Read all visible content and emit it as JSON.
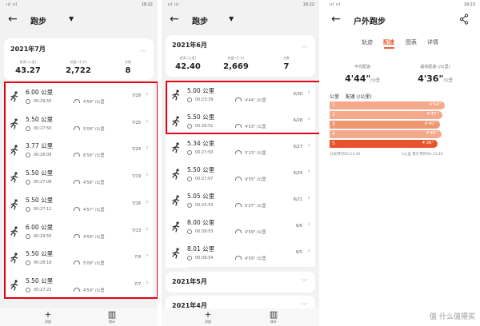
{
  "panels": [
    {
      "status": {
        "signal": "ııl ııl",
        "icons": "✱ ◎ ▭",
        "time": "19:22"
      },
      "title": "跑步",
      "summary": {
        "month": "2021年7月",
        "stats": [
          {
            "label": "距离 (公里)",
            "value": "43.27"
          },
          {
            "label": "热量 (千卡)",
            "value": "2,722"
          },
          {
            "label": "次数",
            "value": "8"
          }
        ]
      },
      "runs": [
        {
          "distance": "6.00 公里",
          "duration": "00:29:55",
          "pace": "4'59\" /公里",
          "date": "7/28"
        },
        {
          "distance": "5.50 公里",
          "duration": "00:27:50",
          "pace": "5'04\" /公里",
          "date": "7/25"
        },
        {
          "distance": "3.77 公里",
          "duration": "00:26:09",
          "pace": "6'56\" /公里",
          "date": "7/24"
        },
        {
          "distance": "5.50 公里",
          "duration": "00:27:08",
          "pace": "4'56\" /公里",
          "date": "7/19"
        },
        {
          "distance": "5.50 公里",
          "duration": "00:27:11",
          "pace": "4'57\" /公里",
          "date": "7/16"
        },
        {
          "distance": "6.00 公里",
          "duration": "00:29:55",
          "pace": "4'59\" /公里",
          "date": "7/13"
        },
        {
          "distance": "5.50 公里",
          "duration": "00:28:18",
          "pace": "5'09\" /公里",
          "date": "7/9"
        },
        {
          "distance": "5.50 公里",
          "duration": "00:27:23",
          "pace": "4'59\" /公里",
          "date": "7/7"
        }
      ],
      "bottom": {
        "add_label": "添加",
        "stats_label": "统计"
      }
    },
    {
      "status": {
        "signal": "ııl ııl",
        "icons": "✱ ◎ ▭",
        "time": "19:22"
      },
      "title": "跑步",
      "summary": {
        "month": "2021年6月",
        "stats": [
          {
            "label": "距离 (公里)",
            "value": "42.40"
          },
          {
            "label": "热量 (千卡)",
            "value": "2,669"
          },
          {
            "label": "次数",
            "value": "7"
          }
        ]
      },
      "runs": [
        {
          "distance": "5.00 公里",
          "duration": "00:23:39",
          "pace": "4'44\" /公里",
          "date": "6/30"
        },
        {
          "distance": "5.50 公里",
          "duration": "00:26:51",
          "pace": "4'53\" /公里",
          "date": "6/28"
        },
        {
          "distance": "5.34 公里",
          "duration": "00:27:50",
          "pace": "5'13\" /公里",
          "date": "6/27"
        },
        {
          "distance": "5.50 公里",
          "duration": "00:27:07",
          "pace": "4'55\" /公里",
          "date": "6/24"
        },
        {
          "distance": "5.05 公里",
          "duration": "00:25:53",
          "pace": "5'07\" /公里",
          "date": "6/21"
        },
        {
          "distance": "8.00 公里",
          "duration": "00:39:53",
          "pace": "4'59\" /公里",
          "date": "6/6"
        },
        {
          "distance": "8.01 公里",
          "duration": "00:39:54",
          "pace": "4'59\" /公里",
          "date": "6/5"
        }
      ],
      "collapsed_months": [
        "2021年5月",
        "2021年4月"
      ],
      "bottom": {
        "add_label": "添加",
        "stats_label": "统计"
      }
    },
    {
      "status": {
        "signal": "ııl ııl",
        "icons": "✱ ◎ ▭",
        "time": "19:23"
      },
      "title": "户外跑步",
      "tabs": [
        "轨迹",
        "配速",
        "图表",
        "详情"
      ],
      "active_tab": 1,
      "avg_pace": {
        "label": "平均配速",
        "value": "4'44\"",
        "unit": "/公里"
      },
      "best_pace": {
        "label": "最快配速 (/公里)",
        "value": "4'36\"",
        "unit": "/公里"
      },
      "section_label": "公里",
      "section_unit": "配速 (/公里)",
      "splits": [
        {
          "km": "1",
          "pace": "4'54\"",
          "fraction": 0.96,
          "color": "#f3a98a"
        },
        {
          "km": "2",
          "pace": "4'47\"",
          "fraction": 0.94,
          "color": "#f3a98a"
        },
        {
          "km": "3",
          "pace": "4'40\"",
          "fraction": 0.92,
          "color": "#f0976f"
        },
        {
          "km": "4",
          "pace": "4'46\"",
          "fraction": 0.93,
          "color": "#f3a98a"
        },
        {
          "km": "5",
          "pace": "4'36\"",
          "fraction": 0.9,
          "color": "#e8532c"
        }
      ],
      "footer_left": "分段用时00:23:40",
      "footer_right": "5公里 累计用时00:23:40"
    }
  ],
  "watermark": "值 什么值得买"
}
